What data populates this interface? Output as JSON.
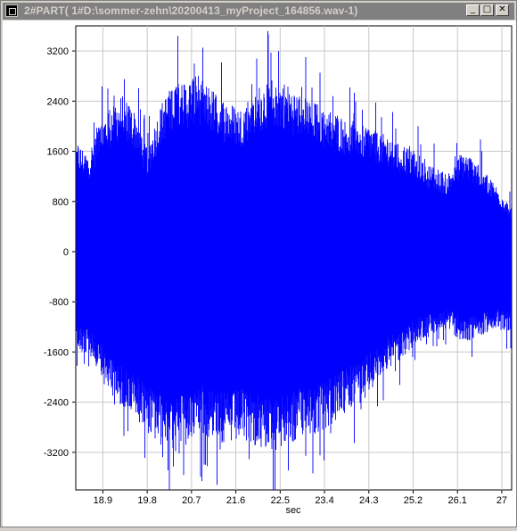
{
  "window": {
    "title": "2#PART( 1#D:\\sommer-zehn\\20200413_myProject_164856.wav-1)",
    "icon": "waveform-app-icon",
    "buttons": {
      "minimize": "_",
      "maximize": "□",
      "close": "✕"
    }
  },
  "chart_data": {
    "type": "area",
    "title": "",
    "xlabel": "sec",
    "ylabel": "",
    "xlim": [
      18.35,
      27.2
    ],
    "ylim": [
      -3800,
      3600
    ],
    "x_ticks": [
      18.9,
      19.8,
      20.7,
      21.6,
      22.5,
      23.4,
      24.3,
      25.2,
      26.1,
      27
    ],
    "x_tick_labels": [
      "18.9",
      "19.8",
      "20.7",
      "21.6",
      "22.5",
      "23.4",
      "24.3",
      "25.2",
      "26.1",
      "27"
    ],
    "y_ticks": [
      3200,
      2400,
      1600,
      800,
      0,
      -800,
      -1600,
      -2400,
      -3200
    ],
    "y_tick_labels": [
      "3200",
      "2400",
      "1600",
      "800",
      "0",
      "-800",
      "-1600",
      "-2400",
      "-3200"
    ],
    "grid": true,
    "color": "#0000ff",
    "series": [
      {
        "x": [
          18.35,
          18.6,
          18.8,
          19.0,
          19.3,
          19.6,
          19.8,
          20.1,
          20.4,
          20.6,
          20.8,
          21.1,
          21.4,
          21.7,
          22.0,
          22.3,
          22.6,
          22.9,
          23.2,
          23.5,
          23.8,
          24.1,
          24.4,
          24.7,
          25.0,
          25.3,
          25.6,
          25.9,
          26.2,
          26.5,
          26.8,
          27.2
        ],
        "max": [
          1700,
          1500,
          1900,
          2200,
          2400,
          2100,
          1600,
          2300,
          2700,
          2600,
          2750,
          2500,
          2300,
          2200,
          2500,
          2650,
          2600,
          2400,
          2300,
          2200,
          2050,
          2000,
          1900,
          1800,
          1650,
          1500,
          1300,
          1200,
          1550,
          1400,
          1100,
          700
        ],
        "min": [
          -1500,
          -1600,
          -1900,
          -2150,
          -2400,
          -2600,
          -2800,
          -3000,
          -3100,
          -3000,
          -2800,
          -2900,
          -3000,
          -2900,
          -3000,
          -3100,
          -3000,
          -2900,
          -2850,
          -2700,
          -2500,
          -2300,
          -2100,
          -1800,
          -1650,
          -1400,
          -1300,
          -1200,
          -1400,
          -1350,
          -1200,
          -1250
        ]
      }
    ]
  }
}
